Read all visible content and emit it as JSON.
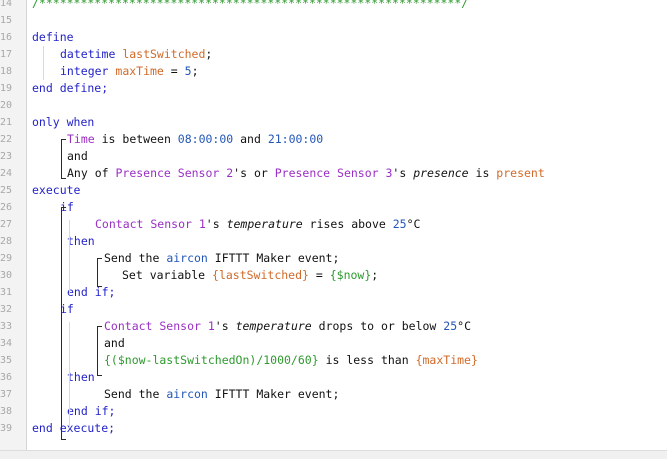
{
  "editor": {
    "lines": [
      {
        "n": "14",
        "segs": [
          {
            "c": "expr",
            "t": "/*************************************************************/"
          }
        ]
      },
      {
        "n": "15",
        "segs": []
      },
      {
        "n": "16",
        "segs": [
          {
            "c": "kw",
            "t": "define"
          }
        ]
      },
      {
        "n": "17",
        "segs": [
          {
            "c": "kw",
            "t": "datetime "
          },
          {
            "c": "var",
            "t": "lastSwitched"
          },
          {
            "c": "plain",
            "t": ";"
          }
        ]
      },
      {
        "n": "18",
        "segs": [
          {
            "c": "kw",
            "t": "integer "
          },
          {
            "c": "var",
            "t": "maxTime"
          },
          {
            "c": "plain",
            "t": " = "
          },
          {
            "c": "lit",
            "t": "5"
          },
          {
            "c": "plain",
            "t": ";"
          }
        ]
      },
      {
        "n": "19",
        "segs": [
          {
            "c": "kw",
            "t": "end define;"
          }
        ]
      },
      {
        "n": "20",
        "segs": []
      },
      {
        "n": "21",
        "segs": [
          {
            "c": "kw",
            "t": "only when"
          }
        ]
      },
      {
        "n": "22",
        "segs": [
          {
            "c": "dev",
            "t": "Time"
          },
          {
            "c": "plain",
            "t": " is between "
          },
          {
            "c": "lit",
            "t": "08:00:00"
          },
          {
            "c": "plain",
            "t": " and "
          },
          {
            "c": "lit",
            "t": "21:00:00"
          }
        ]
      },
      {
        "n": "23",
        "segs": [
          {
            "c": "plain",
            "t": "and"
          }
        ]
      },
      {
        "n": "24",
        "segs": [
          {
            "c": "plain",
            "t": "Any of "
          },
          {
            "c": "dev",
            "t": "Presence Sensor 2"
          },
          {
            "c": "plain",
            "t": "'s or "
          },
          {
            "c": "dev",
            "t": "Presence Sensor 3"
          },
          {
            "c": "plain",
            "t": "'s "
          },
          {
            "c": "em",
            "t": "presence"
          },
          {
            "c": "plain",
            "t": " is "
          },
          {
            "c": "var",
            "t": "present"
          }
        ]
      },
      {
        "n": "25",
        "segs": [
          {
            "c": "kw",
            "t": "execute"
          }
        ]
      },
      {
        "n": "26",
        "segs": [
          {
            "c": "kw",
            "t": "if"
          }
        ]
      },
      {
        "n": "27",
        "segs": [
          {
            "c": "dev",
            "t": "Contact Sensor 1"
          },
          {
            "c": "plain",
            "t": "'s "
          },
          {
            "c": "em",
            "t": "temperature"
          },
          {
            "c": "plain",
            "t": " rises above "
          },
          {
            "c": "lit",
            "t": "25"
          },
          {
            "c": "plain",
            "t": "°C"
          }
        ]
      },
      {
        "n": "28",
        "segs": [
          {
            "c": "kw",
            "t": "then"
          }
        ]
      },
      {
        "n": "29",
        "segs": [
          {
            "c": "plain",
            "t": "Send the "
          },
          {
            "c": "lit",
            "t": "aircon"
          },
          {
            "c": "plain",
            "t": " IFTTT Maker event;"
          }
        ]
      },
      {
        "n": "30",
        "segs": [
          {
            "c": "plain",
            "t": "Set variable "
          },
          {
            "c": "var",
            "t": "{lastSwitched}"
          },
          {
            "c": "plain",
            "t": " = "
          },
          {
            "c": "expr",
            "t": "{$now}"
          },
          {
            "c": "plain",
            "t": ";"
          }
        ]
      },
      {
        "n": "31",
        "segs": [
          {
            "c": "kw",
            "t": "end if;"
          }
        ]
      },
      {
        "n": "32",
        "segs": [
          {
            "c": "kw",
            "t": "if"
          }
        ]
      },
      {
        "n": "33",
        "segs": [
          {
            "c": "dev",
            "t": "Contact Sensor 1"
          },
          {
            "c": "plain",
            "t": "'s "
          },
          {
            "c": "em",
            "t": "temperature"
          },
          {
            "c": "plain",
            "t": " drops to or below "
          },
          {
            "c": "lit",
            "t": "25"
          },
          {
            "c": "plain",
            "t": "°C"
          }
        ]
      },
      {
        "n": "34",
        "segs": [
          {
            "c": "plain",
            "t": "and"
          }
        ]
      },
      {
        "n": "35",
        "segs": [
          {
            "c": "expr",
            "t": "{($now-lastSwitchedOn)/1000/60}"
          },
          {
            "c": "plain",
            "t": " is less than "
          },
          {
            "c": "var",
            "t": "{maxTime}"
          }
        ]
      },
      {
        "n": "36",
        "segs": [
          {
            "c": "kw",
            "t": "then"
          }
        ]
      },
      {
        "n": "37",
        "segs": [
          {
            "c": "plain",
            "t": "Send the "
          },
          {
            "c": "lit",
            "t": "aircon"
          },
          {
            "c": "plain",
            "t": " IFTTT Maker event;"
          }
        ]
      },
      {
        "n": "38",
        "segs": [
          {
            "c": "kw",
            "t": "end if;"
          }
        ]
      },
      {
        "n": "39",
        "segs": [
          {
            "c": "kw",
            "t": "end execute;"
          }
        ]
      }
    ]
  },
  "colors": {
    "keyword": "#2323c8",
    "device": "#9a2fc4",
    "literal": "#2356b8",
    "variable": "#d06a2a",
    "expression": "#2e9a2e",
    "text": "#111111",
    "gutter": "#f3f3f3"
  }
}
